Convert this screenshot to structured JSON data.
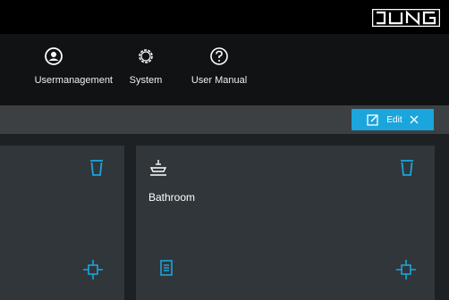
{
  "header": {
    "brand": "JUNG"
  },
  "nav": {
    "items": [
      {
        "label": "Usermanagement",
        "icon": "user-circle-icon"
      },
      {
        "label": "System",
        "icon": "gear-icon"
      },
      {
        "label": "User Manual",
        "icon": "help-circle-icon"
      }
    ]
  },
  "toolbar": {
    "edit_label": "Edit"
  },
  "rooms": [
    {
      "name": ""
    },
    {
      "name": "Bathroom",
      "icon": "bathtub-icon"
    }
  ],
  "colors": {
    "accent": "#1aa5dc",
    "tile": "#31363a",
    "background": "#1e2123"
  }
}
